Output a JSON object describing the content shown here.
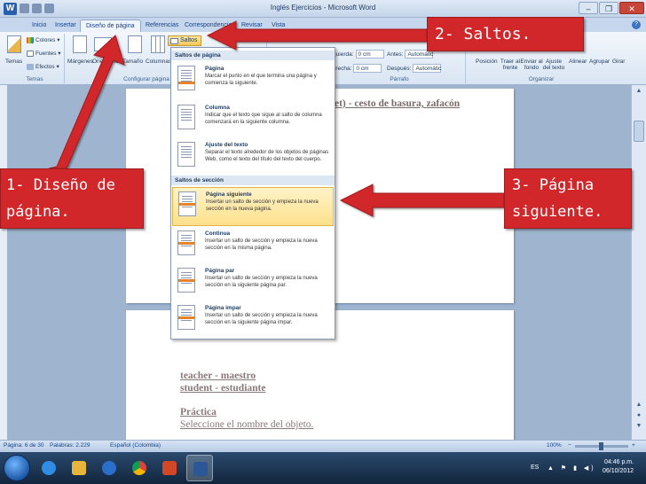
{
  "window": {
    "title": "Inglés Ejercicios - Microsoft Word",
    "controls": [
      "–",
      "❐",
      "✕"
    ],
    "app_icon": "W"
  },
  "tabs": [
    "Inicio",
    "Insertar",
    "Diseño de página",
    "Referencias",
    "Correspondencia",
    "Revisar",
    "Vista"
  ],
  "ribbon": {
    "temas_group": {
      "temas_label": "Temas",
      "colores": "Colores ▾",
      "fuentes": "Fuentes ▾",
      "efectos": "Efectos ▾",
      "group_label": "Temas"
    },
    "configurar_group": {
      "margenes": "Márgenes",
      "orientacion": "Orientación",
      "tamano": "Tamaño",
      "columnas": "Columnas",
      "saltos": "Saltos ▾",
      "group_label": "Configurar página"
    },
    "parrafo_group": {
      "izquierda_label": "Izquierda:",
      "izquierda_value": "0 cm",
      "derecha_label": "Derecha:",
      "derecha_value": "0 cm",
      "antes_label": "Antes:",
      "antes_value": "Automátic",
      "despues_label": "Después:",
      "despues_value": "Automátic",
      "group_label": "Párrafo"
    },
    "organizar_group": {
      "posicion": "Posición",
      "traer": "Traer al frente",
      "enviar": "Enviar al fondo",
      "ajuste": "Ajuste del texto",
      "alinear": "Alinear",
      "agrupar": "Agrupar",
      "girar": "Girar",
      "group_label": "Organizar"
    }
  },
  "menu": {
    "section1": "Saltos de página",
    "section2": "Saltos de sección",
    "items": [
      {
        "title": "Página",
        "desc": "Marcar el punto en el que termina una página y comienza la siguiente."
      },
      {
        "title": "Columna",
        "desc": "Indicar que el texto que sigue al salto de columna comenzará en la siguiente columna."
      },
      {
        "title": "Ajuste del texto",
        "desc": "Separar el texto alrededor de los objetos de páginas Web, como el texto del título del texto del cuerpo."
      },
      {
        "title": "Página siguiente",
        "desc": "Insertar un salto de sección y empieza la nueva sección en la nueva página."
      },
      {
        "title": "Continua",
        "desc": "Insertar un salto de sección y empieza la nueva sección en la misma página."
      },
      {
        "title": "Página par",
        "desc": "Insertar un salto de sección y empieza la nueva sección en la siguiente página par."
      },
      {
        "title": "Página impar",
        "desc": "Insertar un salto de sección y empieza la nueva sección en la siguiente página impar."
      }
    ]
  },
  "document": {
    "page1_heading": "et) - cesto de basura, zafacón",
    "page2_line1": "teacher - maestro",
    "page2_line2": "student - estudiante",
    "page2_line3": "Práctica",
    "page2_line4": "Seleccione el nombre del objeto."
  },
  "callouts": {
    "one": "1- Diseño de página.",
    "two": "2- Saltos.",
    "three": "3- Página siguiente."
  },
  "statusbar": {
    "page": "Página: 6 de 30",
    "words": "Palabras: 2.229",
    "language": "Español (Colombia)",
    "zoom": "100%",
    "zoom_minus": "−",
    "zoom_plus": "+"
  },
  "taskbar": {
    "lang": "ES",
    "time": "04:46 p.m.",
    "date": "06/10/2012",
    "tray_icons": "▲ ⚑ ▮ ◀)"
  },
  "colors": {
    "callout": "#d1262a",
    "ribbon": "#dbe6f4",
    "highlight": "#fde08c"
  }
}
